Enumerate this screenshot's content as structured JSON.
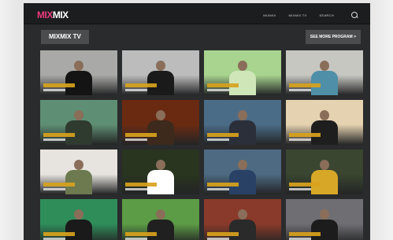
{
  "logo": {
    "part1": "MIX",
    "part2": "MIX"
  },
  "nav": {
    "items": [
      "MIXMIX",
      "MIXMIX TV",
      "SEARCH"
    ]
  },
  "page_title": "MIXMIX TV",
  "see_more_label": "SEE MORE PROGRAM >",
  "colors": {
    "accent": "#e83a7c",
    "caption": "#d8a21c",
    "background": "#2a2b2c"
  },
  "thumbnails": [
    {
      "bg": "#a9aaa7",
      "shirt": "#141414"
    },
    {
      "bg": "#bcbcbc",
      "shirt": "#1a1a1a"
    },
    {
      "bg": "#a8d48f",
      "shirt": "#cfe6b9"
    },
    {
      "bg": "#c7c7c2",
      "shirt": "#4f8fa8"
    },
    {
      "bg": "#5e8e73",
      "shirt": "#2f3b2f"
    },
    {
      "bg": "#6a2a12",
      "shirt": "#3d2a1c"
    },
    {
      "bg": "#4b6c87",
      "shirt": "#2b2f3a"
    },
    {
      "bg": "#e4d2b0",
      "shirt": "#1e1e1e"
    },
    {
      "bg": "#e7e4df",
      "shirt": "#6d7a50"
    },
    {
      "bg": "#29351f",
      "shirt": "#ffffff"
    },
    {
      "bg": "#4d6a82",
      "shirt": "#2a4166"
    },
    {
      "bg": "#3a4630",
      "shirt": "#d7a827"
    },
    {
      "bg": "#2f8d5a",
      "shirt": "#1a1a1a"
    },
    {
      "bg": "#5c9c46",
      "shirt": "#202020"
    },
    {
      "bg": "#8a3a2a",
      "shirt": "#2a2a2a"
    },
    {
      "bg": "#6f6f73",
      "shirt": "#1c1c1c"
    }
  ]
}
